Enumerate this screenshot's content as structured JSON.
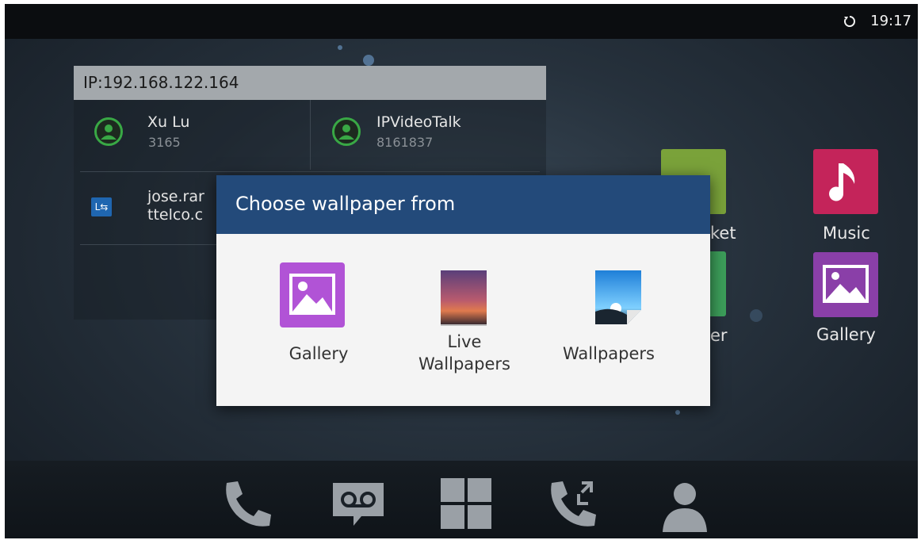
{
  "status_bar": {
    "time": "19:17",
    "sync_icon": "sync-icon"
  },
  "widget": {
    "ip": "IP:192.168.122.164",
    "contacts": [
      {
        "name": "Xu Lu",
        "number": "3165",
        "icon": "contact-avatar-icon"
      },
      {
        "name": "IPVideoTalk",
        "number": "8161837",
        "icon": "contact-avatar-icon"
      },
      {
        "name_line1": "jose.rar",
        "name_line2": "ttelco.c",
        "icon": "lync-icon"
      }
    ]
  },
  "apps": [
    {
      "label": "Music",
      "icon": "music-note-icon",
      "color": "#c4245a"
    },
    {
      "label": "Gallery",
      "icon": "gallery-image-icon",
      "color": "#8a3fa8"
    },
    {
      "label": "ket",
      "icon": "market-icon",
      "color": "#7aa23a"
    },
    {
      "label": "er",
      "icon": "file-manager-icon",
      "color": "#3c9e5a"
    }
  ],
  "dialog": {
    "title": "Choose wallpaper from",
    "options": [
      {
        "label": "Gallery",
        "icon": "gallery-icon",
        "color": "#b153d6"
      },
      {
        "label_line1": "Live",
        "label_line2": "Wallpapers",
        "icon": "live-wallpapers-icon"
      },
      {
        "label": "Wallpapers",
        "icon": "wallpapers-icon"
      }
    ]
  },
  "dock": {
    "items": [
      {
        "icon": "phone-icon"
      },
      {
        "icon": "voicemail-icon"
      },
      {
        "icon": "app-grid-icon"
      },
      {
        "icon": "call-transfer-icon"
      },
      {
        "icon": "contacts-person-icon"
      }
    ]
  }
}
